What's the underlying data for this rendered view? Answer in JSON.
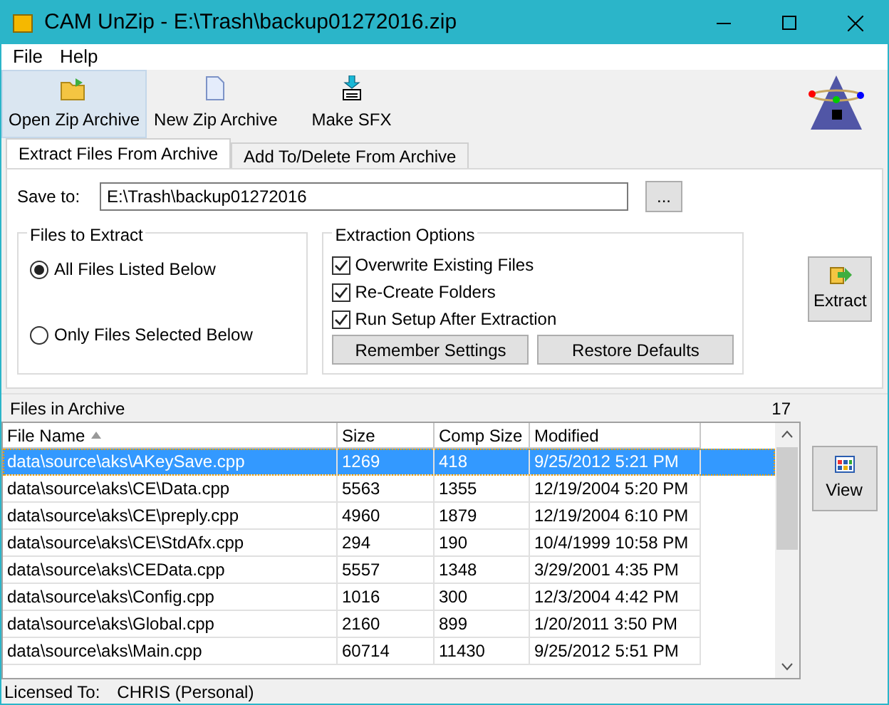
{
  "window": {
    "title": "CAM UnZip - E:\\Trash\\backup01272016.zip"
  },
  "menu": [
    "File",
    "Help"
  ],
  "toolbar": [
    {
      "label": "Open Zip Archive",
      "kind": "open",
      "selected": true
    },
    {
      "label": "New Zip Archive",
      "kind": "new",
      "selected": false
    },
    {
      "label": "Make SFX",
      "kind": "sfx",
      "selected": false
    }
  ],
  "tabs": [
    {
      "label": "Extract Files From Archive",
      "selected": true
    },
    {
      "label": "Add To/Delete From Archive",
      "selected": false
    }
  ],
  "save_to": {
    "label": "Save to:",
    "value": "E:\\Trash\\backup01272016",
    "browse": "..."
  },
  "files_to_extract": {
    "title": "Files to Extract",
    "options": [
      {
        "label": "All Files Listed Below",
        "selected": true
      },
      {
        "label": "Only Files Selected Below",
        "selected": false
      }
    ]
  },
  "extraction_options": {
    "title": "Extraction Options",
    "options": [
      {
        "label": "Overwrite Existing Files",
        "checked": true
      },
      {
        "label": "Re-Create Folders",
        "checked": true
      },
      {
        "label": "Run Setup After Extraction",
        "checked": true
      }
    ],
    "buttons": [
      "Remember Settings",
      "Restore Defaults"
    ]
  },
  "extract_button": "Extract",
  "files_header": {
    "label": "Files in Archive",
    "count": "17"
  },
  "table": {
    "columns": [
      "File Name",
      "Size",
      "Comp Size",
      "Modified"
    ],
    "rows": [
      {
        "cells": [
          "data\\source\\aks\\AKeySave.cpp",
          "1269",
          "418",
          "9/25/2012 5:21 PM"
        ],
        "selected": true
      },
      {
        "cells": [
          "data\\source\\aks\\CE\\Data.cpp",
          "5563",
          "1355",
          "12/19/2004 5:20 PM"
        ],
        "selected": false
      },
      {
        "cells": [
          "data\\source\\aks\\CE\\preply.cpp",
          "4960",
          "1879",
          "12/19/2004 6:10 PM"
        ],
        "selected": false
      },
      {
        "cells": [
          "data\\source\\aks\\CE\\StdAfx.cpp",
          "294",
          "190",
          "10/4/1999 10:58 PM"
        ],
        "selected": false
      },
      {
        "cells": [
          "data\\source\\aks\\CEData.cpp",
          "5557",
          "1348",
          "3/29/2001 4:35 PM"
        ],
        "selected": false
      },
      {
        "cells": [
          "data\\source\\aks\\Config.cpp",
          "1016",
          "300",
          "12/3/2004 4:42 PM"
        ],
        "selected": false
      },
      {
        "cells": [
          "data\\source\\aks\\Global.cpp",
          "2160",
          "899",
          "1/20/2011 3:50 PM"
        ],
        "selected": false
      },
      {
        "cells": [
          "data\\source\\aks\\Main.cpp",
          "60714",
          "11430",
          "9/25/2012 5:51 PM"
        ],
        "selected": false
      }
    ]
  },
  "view_button": "View",
  "status_bar": {
    "label": "Licensed To:",
    "value": "CHRIS (Personal)"
  }
}
